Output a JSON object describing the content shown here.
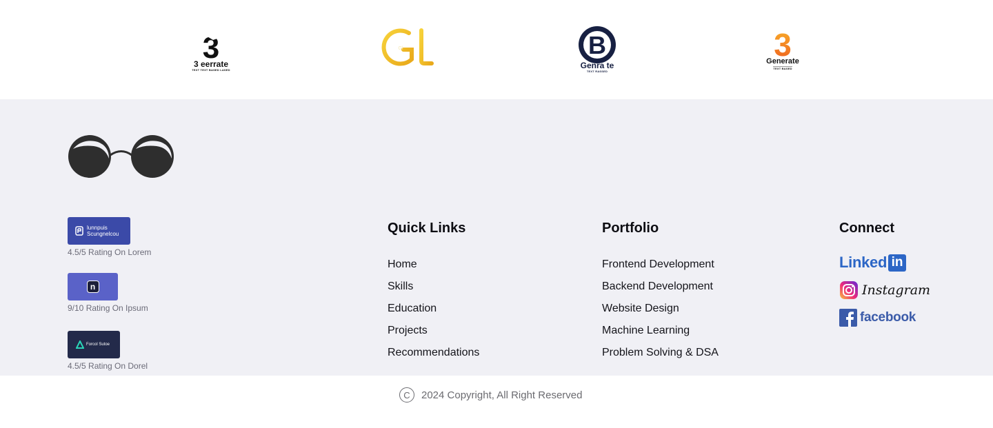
{
  "partner_logos": [
    {
      "mark": "3",
      "name": "3 eerrate",
      "sub": "TEXT TEXT BASED LASED"
    },
    {
      "mark": "Gl",
      "name": "",
      "sub": ""
    },
    {
      "mark": "B",
      "name": "Genra te",
      "sub": "TEXT RASSED"
    },
    {
      "mark": "3",
      "name": "Generate",
      "sub": "TEXT BASED"
    }
  ],
  "badges": [
    {
      "label": "lunnpuis\nScungnelcou",
      "rating": "4.5/5 Rating On Lorem",
      "color": "#3b4aa8"
    },
    {
      "label": "n",
      "rating": "9/10 Rating On Ipsum",
      "color": "#5a62c8"
    },
    {
      "label": "Forcol Sutoe",
      "rating": "4.5/5 Rating On Dorel",
      "color": "#232a4a"
    }
  ],
  "quick_links": {
    "heading": "Quick Links",
    "items": [
      "Home",
      "Skills",
      "Education",
      "Projects",
      "Recommendations"
    ]
  },
  "portfolio": {
    "heading": "Portfolio",
    "items": [
      "Frontend Development",
      "Backend Development",
      "Website Design",
      "Machine Learning",
      "Problem Solving & DSA"
    ]
  },
  "connect": {
    "heading": "Connect",
    "linkedin": {
      "text": "Linked",
      "suffix": "in",
      "color": "#2c66c6"
    },
    "instagram": {
      "text": "Instagram"
    },
    "facebook": {
      "text": "facebook",
      "color": "#3b5ba9"
    }
  },
  "copyright": {
    "symbol": "C",
    "text": "2024 Copyright, All Right Reserved"
  }
}
